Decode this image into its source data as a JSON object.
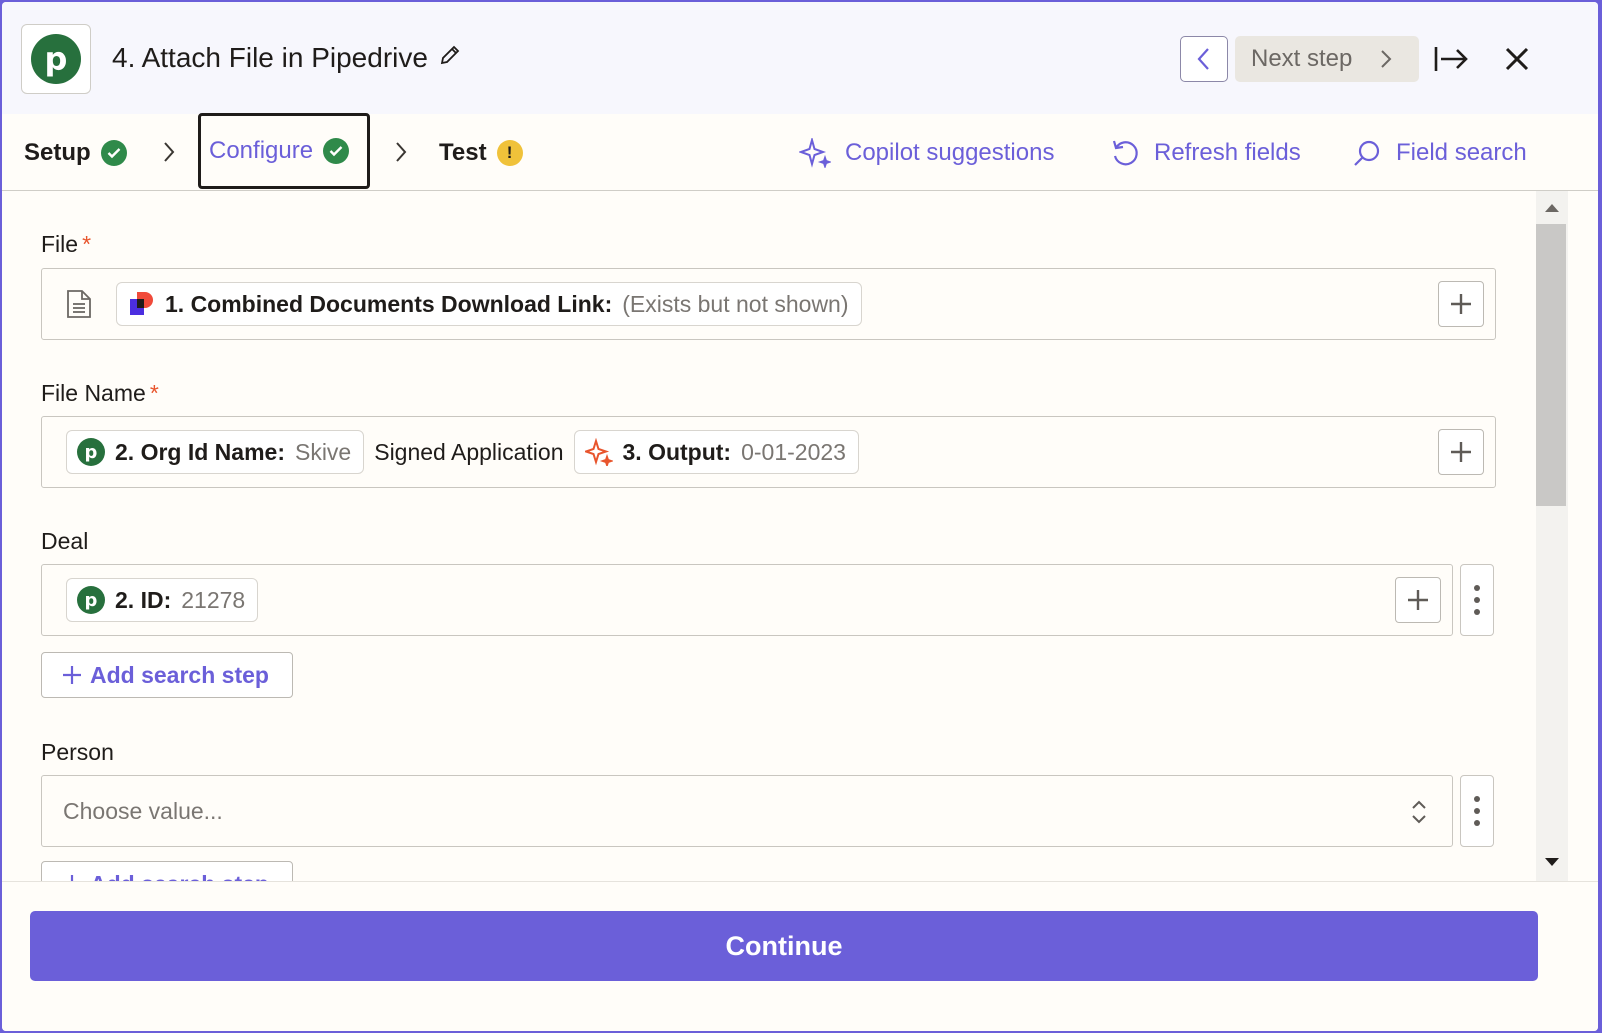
{
  "header": {
    "step_title": "4. Attach File in Pipedrive",
    "next_step_label": "Next step"
  },
  "tabs": [
    {
      "label": "Setup",
      "status": "complete"
    },
    {
      "label": "Configure",
      "status": "complete",
      "active": true
    },
    {
      "label": "Test",
      "status": "warning"
    }
  ],
  "toolbar": {
    "copilot_label": "Copilot suggestions",
    "refresh_label": "Refresh fields",
    "field_search_label": "Field search"
  },
  "fields": {
    "file": {
      "label": "File",
      "required_mark": "*",
      "pill_key": "1. Combined Documents Download Link:",
      "pill_value": "(Exists but not shown)"
    },
    "file_name": {
      "label": "File Name",
      "required_mark": "*",
      "pill1_key": "2. Org Id Name:",
      "pill1_value": "Skive",
      "text": "Signed Application",
      "pill2_key": "3. Output:",
      "pill2_value": "0-01-2023"
    },
    "deal": {
      "label": "Deal",
      "pill_key": "2. ID:",
      "pill_value": "21278",
      "add_search_label": "Add search step"
    },
    "person": {
      "label": "Person",
      "placeholder": "Choose value...",
      "add_search_label": "Add search step"
    }
  },
  "footer": {
    "continue_label": "Continue"
  },
  "colors": {
    "accent": "#6b5fd9",
    "success": "#2f8a4a",
    "warning": "#f0c23a",
    "pipedrive": "#27703d",
    "required": "#e8552d"
  }
}
